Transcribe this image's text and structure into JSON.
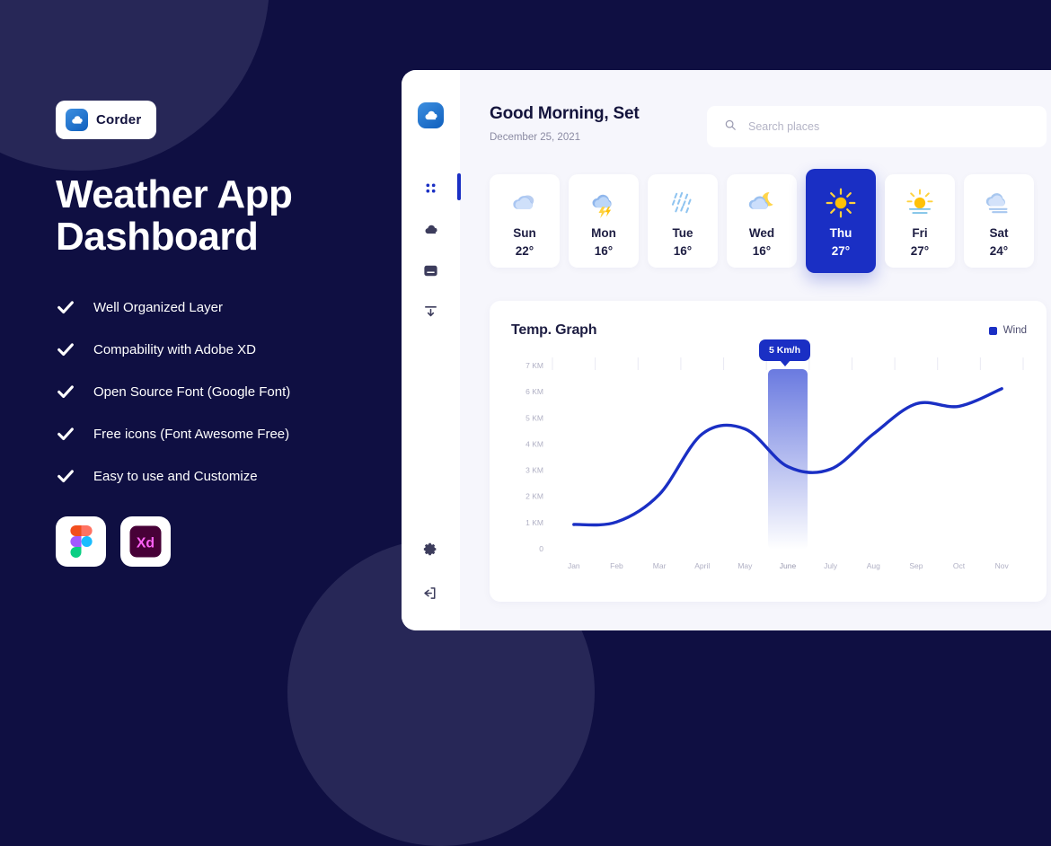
{
  "promo": {
    "badge": {
      "label": "Corder",
      "icon": "cloud-icon"
    },
    "title_line1": "Weather App",
    "title_line2": "Dashboard",
    "features": [
      "Well Organized Layer",
      "Compability with Adobe XD",
      "Open Source Font (Google Font)",
      "Free icons (Font Awesome Free)",
      "Easy to use and Customize"
    ],
    "tools": [
      {
        "name": "figma-logo"
      },
      {
        "name": "adobe-xd-logo",
        "label": "Xd"
      }
    ],
    "background_color": "#0f0f42",
    "circle_color": "#272757"
  },
  "dashboard": {
    "sidebar": {
      "logo": "cloud-logo-icon",
      "items": [
        {
          "name": "dashboard",
          "icon": "grid-icon",
          "active": true
        },
        {
          "name": "weather",
          "icon": "cloud-icon",
          "active": false
        },
        {
          "name": "inbox",
          "icon": "inbox-icon",
          "active": false
        },
        {
          "name": "downloads",
          "icon": "download-icon",
          "active": false
        }
      ],
      "bottom_items": [
        {
          "name": "settings",
          "icon": "gear-icon"
        },
        {
          "name": "logout",
          "icon": "logout-icon"
        }
      ]
    },
    "header": {
      "greeting": "Good Morning, Set",
      "date": "December 25, 2021"
    },
    "search": {
      "placeholder": "Search places",
      "value": "",
      "icon": "search-icon"
    },
    "forecast": [
      {
        "day": "Sun",
        "temp": "22°",
        "icon": "cloudy",
        "active": false
      },
      {
        "day": "Mon",
        "temp": "16°",
        "icon": "thunderstorm",
        "active": false
      },
      {
        "day": "Tue",
        "temp": "16°",
        "icon": "rain",
        "active": false
      },
      {
        "day": "Wed",
        "temp": "16°",
        "icon": "night-cloudy",
        "active": false
      },
      {
        "day": "Thu",
        "temp": "27°",
        "icon": "sunny",
        "active": true
      },
      {
        "day": "Fri",
        "temp": "27°",
        "icon": "sunset",
        "active": false
      },
      {
        "day": "Sat",
        "temp": "24°",
        "icon": "fog",
        "active": false
      }
    ],
    "accent_color": "#1a2fc4",
    "panel_bg": "#f6f6fc"
  },
  "chart_data": {
    "type": "line",
    "title": "Temp. Graph",
    "xlabel": "",
    "ylabel": "",
    "legend": [
      {
        "name": "Wind",
        "color": "#1a2fc4"
      }
    ],
    "legend_position": "top-right",
    "grid": true,
    "categories": [
      "Jan",
      "Feb",
      "Mar",
      "April",
      "May",
      "June",
      "July",
      "Aug",
      "Sep",
      "Oct",
      "Nov"
    ],
    "ytick_labels": [
      "7 KM",
      "6 KM",
      "5 KM",
      "4 KM",
      "3 KM",
      "2 KM",
      "1 KM",
      "0"
    ],
    "ylim": [
      0,
      7.5
    ],
    "series": [
      {
        "name": "Wind",
        "color": "#1a2fc4",
        "values": [
          1.0,
          1.1,
          2.2,
          4.6,
          4.8,
          3.3,
          3.2,
          4.6,
          5.8,
          5.7,
          6.4
        ]
      }
    ],
    "highlight": {
      "category": "June",
      "tooltip": "5 Km/h",
      "bar_color": "#6a7ae0"
    }
  }
}
